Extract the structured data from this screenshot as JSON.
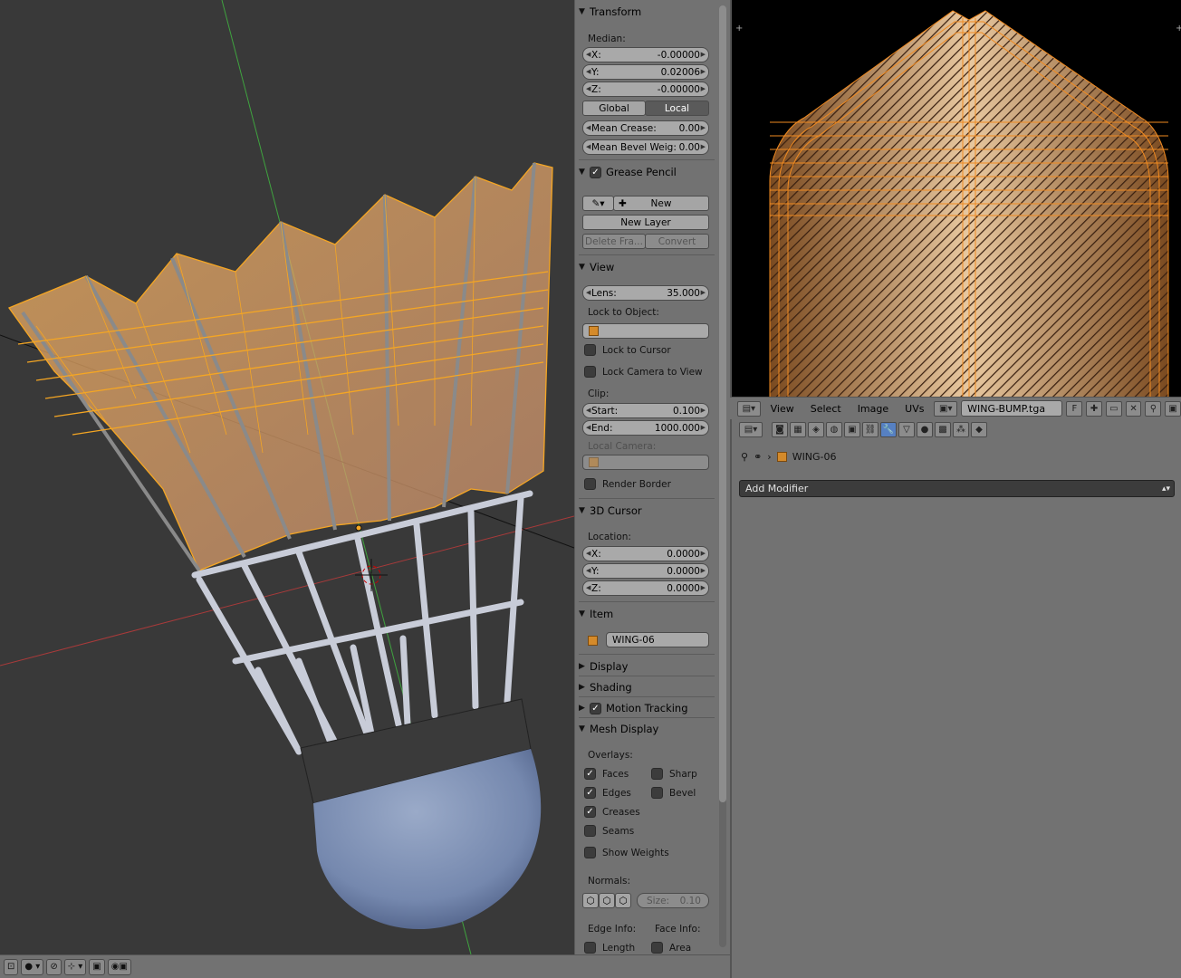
{
  "npanel": {
    "transform": {
      "title": "Transform",
      "median_label": "Median:",
      "x_label": "X:",
      "x_value": "-0.00000",
      "y_label": "Y:",
      "y_value": "0.02006",
      "z_label": "Z:",
      "z_value": "-0.00000",
      "global_label": "Global",
      "local_label": "Local",
      "crease_label": "Mean Crease:",
      "crease_value": "0.00",
      "bevel_label": "Mean Bevel Weig:",
      "bevel_value": "0.00"
    },
    "grease_pencil": {
      "title": "Grease Pencil",
      "new_label": "New",
      "new_layer_label": "New Layer",
      "delete_frame_label": "Delete Fra...",
      "convert_label": "Convert"
    },
    "view": {
      "title": "View",
      "lens_label": "Lens:",
      "lens_value": "35.000",
      "lock_object_label": "Lock to Object:",
      "lock_cursor_label": "Lock to Cursor",
      "lock_camera_label": "Lock Camera to View",
      "clip_label": "Clip:",
      "start_label": "Start:",
      "start_value": "0.100",
      "end_label": "End:",
      "end_value": "1000.000",
      "local_camera_label": "Local Camera:",
      "render_border_label": "Render Border"
    },
    "cursor": {
      "title": "3D Cursor",
      "location_label": "Location:",
      "x_label": "X:",
      "x_value": "0.0000",
      "y_label": "Y:",
      "y_value": "0.0000",
      "z_label": "Z:",
      "z_value": "0.0000"
    },
    "item": {
      "title": "Item",
      "name": "WING-06"
    },
    "display_title": "Display",
    "shading_title": "Shading",
    "motion_tracking_title": "Motion Tracking",
    "mesh_display": {
      "title": "Mesh Display",
      "overlays_label": "Overlays:",
      "faces": "Faces",
      "sharp": "Sharp",
      "edges": "Edges",
      "bevel": "Bevel",
      "creases": "Creases",
      "seams": "Seams",
      "show_weights": "Show Weights",
      "normals_label": "Normals:",
      "size_label": "Size:",
      "size_value": "0.10",
      "edge_info_label": "Edge Info:",
      "face_info_label": "Face Info:",
      "length": "Length",
      "area": "Area"
    }
  },
  "uv_header": {
    "view": "View",
    "select": "Select",
    "image": "Image",
    "uvs": "UVs",
    "image_name": "WING-BUMP.tga",
    "f_label": "F"
  },
  "properties": {
    "object_name": "WING-06",
    "add_modifier": "Add Modifier"
  },
  "colors": {
    "wireframe": "#f5a623",
    "panel_bg": "#727272",
    "viewport_bg": "#393939",
    "active_tab": "#5680c2"
  }
}
